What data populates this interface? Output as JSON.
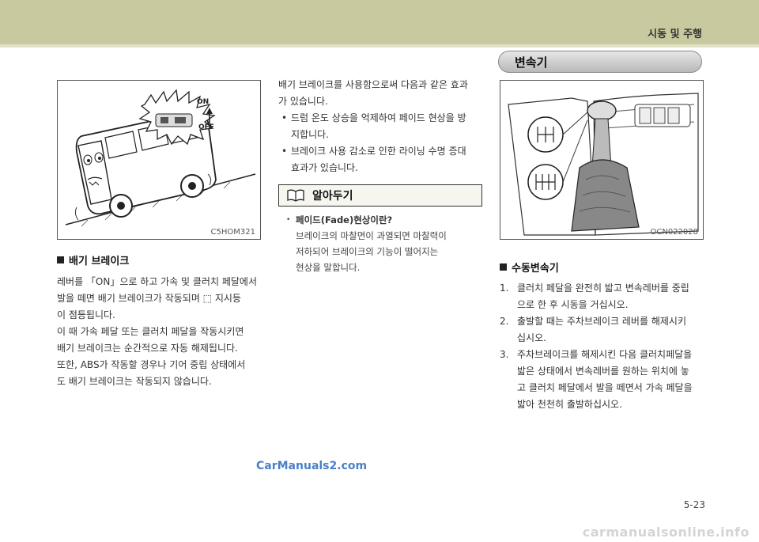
{
  "header": {
    "section": "시동 및 주행"
  },
  "left": {
    "figure_code": "C5HOM321",
    "heading": "배기 브레이크",
    "paragraphs": [
      "레버를 「ON」으로 하고 가속 및 클러치 페달에서",
      "발을 떼면 배기 브레이크가 작동되며 ⬚ 지시등",
      "이 점등됩니다.",
      "이 때 가속 페달 또는 클러치 페달을 작동시키면",
      "배기 브레이크는 순간적으로 자동 해제됩니다.",
      "또한, ABS가 작동할 경우나 기어 중립 상태에서",
      "도 배기 브레이크는 작동되지 않습니다."
    ],
    "lever_on": "ON",
    "lever_off": "OFF"
  },
  "middle": {
    "intro": [
      "배기 브레이크를 사용함으로써 다음과 같은 효과",
      "가 있습니다."
    ],
    "bullets": [
      [
        "드럼 온도 상승을 억제하여 페이드 현상을 방",
        "지합니다."
      ],
      [
        "브레이크 사용 감소로 인한 라이닝 수명 증대",
        "효과가 있습니다."
      ]
    ],
    "note_title": "알아두기",
    "note_heading": "페이드(Fade)현상이란?",
    "note_lines": [
      "브레이크의 마찰면이 과열되면 마찰력이",
      "저하되어  브레이크의 기능이 떨어지는",
      "현상을 말합니다."
    ]
  },
  "right": {
    "section_pill": "변속기",
    "figure_code": "OCN022028",
    "heading": "수동변속기",
    "steps": [
      {
        "num": "1.",
        "lines": [
          "클러치 페달을 완전히 밟고 변속레버를 중립",
          "으로 한 후 시동을 거십시오."
        ]
      },
      {
        "num": "2.",
        "lines": [
          "출발할 때는 주차브레이크 레버를 해제시키",
          "십시오."
        ]
      },
      {
        "num": "3.",
        "lines": [
          "주차브레이크를 해제시킨 다음 클러치페달을",
          "밟은 상태에서 변속레버를 원하는 위치에 놓",
          "고 클러치 페달에서 발을 떼면서 가속 페달을",
          "밟아 천천히 출발하십시오."
        ]
      }
    ]
  },
  "footer": {
    "watermark": "CarManuals2.com",
    "page_number": "5-23",
    "site_mark": "carmanualsonline.info"
  }
}
